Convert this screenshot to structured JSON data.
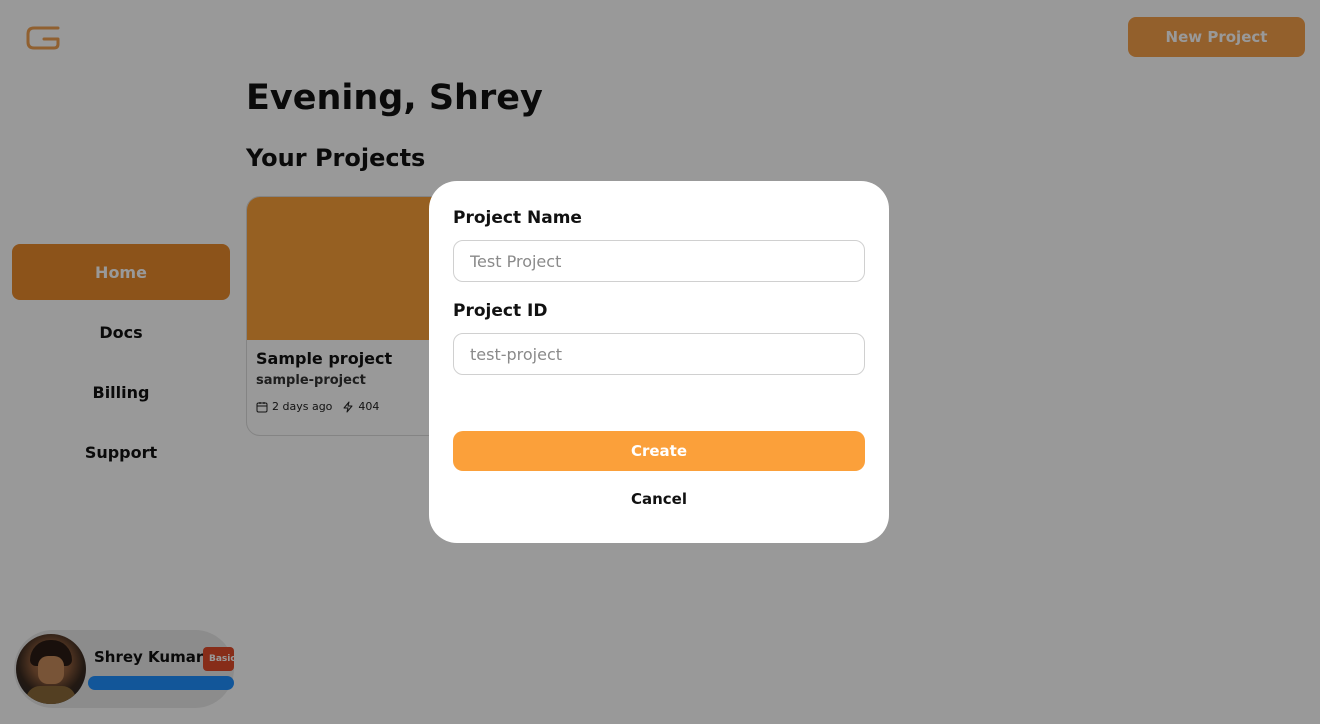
{
  "header": {
    "logo_icon": "g-logo-icon",
    "new_project_label": "New Project"
  },
  "sidebar": {
    "items": [
      {
        "label": "Home",
        "active": true
      },
      {
        "label": "Docs",
        "active": false
      },
      {
        "label": "Billing",
        "active": false
      },
      {
        "label": "Support",
        "active": false
      }
    ]
  },
  "profile": {
    "name": "Shrey Kumar",
    "plan_badge": "Basic"
  },
  "main": {
    "greeting": "Evening, Shrey",
    "section_title": "Your Projects",
    "projects": [
      {
        "name": "Sample project",
        "id": "sample-project",
        "updated": "2 days ago",
        "requests": "404"
      }
    ]
  },
  "modal": {
    "project_name_label": "Project Name",
    "project_name_placeholder": "Test Project",
    "project_name_value": "",
    "project_id_label": "Project ID",
    "project_id_placeholder": "test-project",
    "project_id_value": "",
    "create_label": "Create",
    "cancel_label": "Cancel"
  },
  "colors": {
    "accent": "#fba03a",
    "accent_dark": "#e98a2c",
    "badge": "#e14b2a",
    "overlay": "rgba(0,0,0,0.40)"
  }
}
